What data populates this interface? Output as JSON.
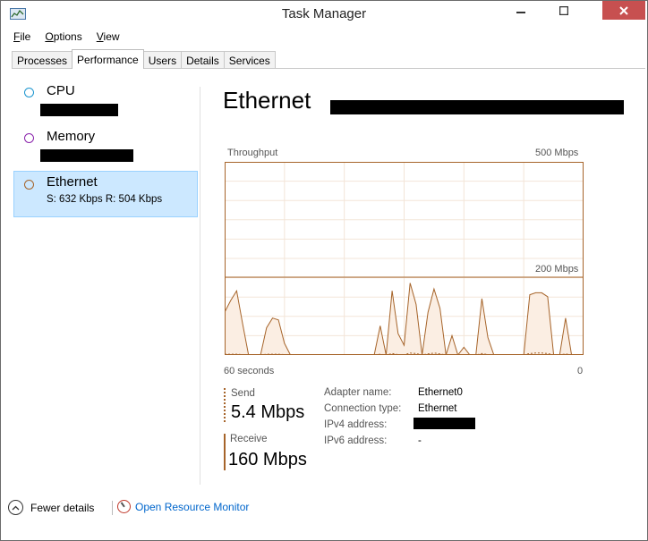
{
  "window": {
    "title": "Task Manager"
  },
  "menu": [
    "File",
    "Options",
    "View"
  ],
  "tabs": [
    {
      "label": "Processes",
      "active": false
    },
    {
      "label": "Performance",
      "active": true
    },
    {
      "label": "Users",
      "active": false
    },
    {
      "label": "Details",
      "active": false
    },
    {
      "label": "Services",
      "active": false
    }
  ],
  "sidebar": {
    "items": [
      {
        "name": "CPU",
        "subtitle": "",
        "color": "#1c95cf"
      },
      {
        "name": "Memory",
        "subtitle": "",
        "color": "#8b24ac"
      },
      {
        "name": "Ethernet",
        "subtitle": "S: 632 Kbps  R: 504 Kbps",
        "color": "#a6642a"
      }
    ]
  },
  "main": {
    "title": "Ethernet",
    "graph": {
      "label": "Throughput",
      "max_label": "500 Mbps",
      "mid_label": "200 Mbps",
      "left_label": "60 seconds",
      "right_label": "0"
    },
    "send": {
      "label": "Send",
      "value": "5.4 Mbps"
    },
    "receive": {
      "label": "Receive",
      "value": "160 Mbps"
    },
    "details": {
      "adapter_name_label": "Adapter name:",
      "adapter_name_value": "Ethernet0",
      "connection_type_label": "Connection type:",
      "connection_type_value": "Ethernet",
      "ipv4_label": "IPv4 address:",
      "ipv6_label": "IPv6 address:",
      "ipv6_value": "-"
    }
  },
  "footer": {
    "fewer_details": "Fewer details",
    "open_resource_monitor": "Open Resource Monitor"
  },
  "chart_data": {
    "type": "area",
    "ylabel": "Throughput",
    "xlabel": "60 seconds",
    "scale_max_mbps": 200,
    "x_seconds_ago": [
      60,
      59,
      58,
      57,
      56,
      55,
      54,
      53,
      52,
      51,
      50,
      49,
      48,
      47,
      46,
      45,
      44,
      43,
      42,
      41,
      40,
      39,
      38,
      37,
      36,
      35,
      34,
      33,
      32,
      31,
      30,
      29,
      28,
      27,
      26,
      25,
      24,
      23,
      22,
      21,
      20,
      19,
      18,
      17,
      16,
      15,
      14,
      13,
      12,
      11,
      10,
      9,
      8,
      7,
      6,
      5,
      4,
      3,
      2,
      1,
      0
    ],
    "series": [
      {
        "name": "Receive",
        "values": [
          110,
          140,
          165,
          80,
          0,
          0,
          0,
          70,
          95,
          90,
          30,
          0,
          0,
          0,
          0,
          0,
          0,
          0,
          0,
          0,
          0,
          0,
          0,
          0,
          0,
          0,
          75,
          0,
          165,
          55,
          25,
          185,
          130,
          0,
          110,
          170,
          120,
          0,
          50,
          0,
          20,
          0,
          0,
          145,
          45,
          0,
          0,
          0,
          0,
          0,
          0,
          155,
          160,
          160,
          150,
          0,
          0,
          95,
          0,
          0,
          0
        ],
        "color": "#a6642a"
      },
      {
        "name": "Send",
        "values": [
          2,
          2,
          2,
          1,
          0,
          0,
          0,
          2,
          2,
          2,
          1,
          0,
          0,
          0,
          0,
          0,
          0,
          0,
          0,
          0,
          0,
          0,
          0,
          0,
          0,
          0,
          2,
          0,
          4,
          1,
          1,
          5,
          4,
          0,
          3,
          5,
          3,
          0,
          1,
          0,
          1,
          0,
          0,
          4,
          1,
          0,
          0,
          0,
          0,
          0,
          0,
          4,
          5,
          5,
          4,
          0,
          0,
          3,
          0,
          0,
          0
        ],
        "color": "#a6642a"
      }
    ]
  }
}
